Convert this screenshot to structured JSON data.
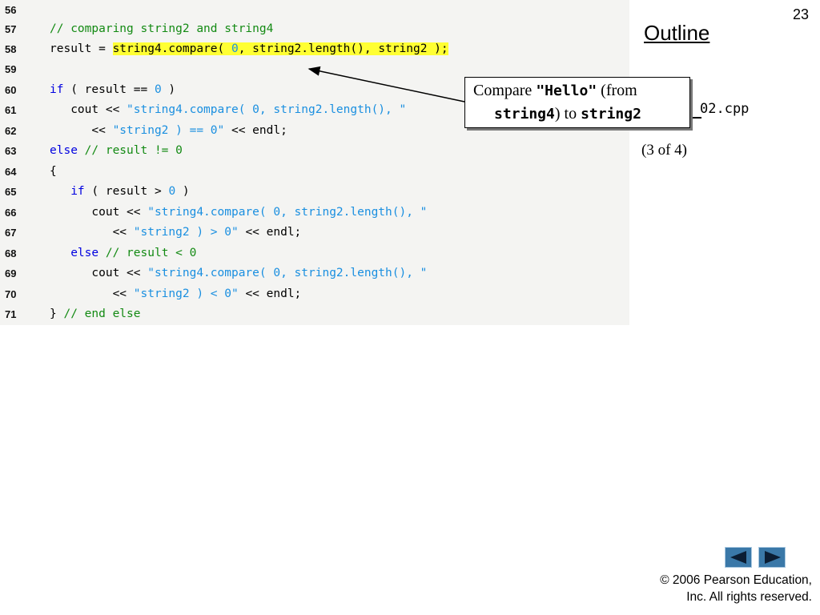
{
  "slide": {
    "number": "23",
    "outline_label": "Outline",
    "filename": "02.cpp",
    "part": "(3 of 4)"
  },
  "callout": {
    "t1": "Compare ",
    "t2": "\"Hello\"",
    "t3": " (from",
    "t4": "string4",
    "t5": ") to ",
    "t6": "string2"
  },
  "code": {
    "l56": {
      "n": "56"
    },
    "l57": {
      "n": "57",
      "c1": "// comparing string2 and string4"
    },
    "l58": {
      "n": "58",
      "p1": "result = ",
      "h1": "string4.compare( ",
      "h2": "0",
      "h3": ", string2.length(), string2 );"
    },
    "l59": {
      "n": "59"
    },
    "l60": {
      "n": "60",
      "k1": "if",
      "p1": " ( result == ",
      "num": "0",
      "p2": " )"
    },
    "l61": {
      "n": "61",
      "p1": "   cout << ",
      "s1": "\"string4.compare( 0, string2.length(), \""
    },
    "l62": {
      "n": "62",
      "p1": "      << ",
      "s1": "\"string2 ) == 0\"",
      "p2": " << endl;"
    },
    "l63": {
      "n": "63",
      "k1": "else",
      "p1": " ",
      "c1": "// result != 0"
    },
    "l64": {
      "n": "64",
      "p1": "{"
    },
    "l65": {
      "n": "65",
      "p0": "   ",
      "k1": "if",
      "p1": " ( result > ",
      "num": "0",
      "p2": " )"
    },
    "l66": {
      "n": "66",
      "p1": "      cout << ",
      "s1": "\"string4.compare( 0, string2.length(), \""
    },
    "l67": {
      "n": "67",
      "p1": "         << ",
      "s1": "\"string2 ) > 0\"",
      "p2": " << endl;"
    },
    "l68": {
      "n": "68",
      "p0": "   ",
      "k1": "else",
      "p1": " ",
      "c1": "// result < 0"
    },
    "l69": {
      "n": "69",
      "p1": "      cout << ",
      "s1": "\"string4.compare( 0, string2.length(), \""
    },
    "l70": {
      "n": "70",
      "p1": "         << ",
      "s1": "\"string2 ) < 0\"",
      "p2": " << endl;"
    },
    "l71": {
      "n": "71",
      "p1": "} ",
      "c1": "// end else"
    }
  },
  "nav": {
    "prev_icon": "arrow-left-icon",
    "next_icon": "arrow-right-icon",
    "button_color": "#3a78a8"
  },
  "copyright": {
    "line1": "© 2006 Pearson Education,",
    "line2": "Inc.  All rights reserved."
  },
  "colors": {
    "keyword": "#0000e0",
    "comment": "#138a13",
    "string": "#1a8fe0",
    "highlight": "#ffff33"
  }
}
